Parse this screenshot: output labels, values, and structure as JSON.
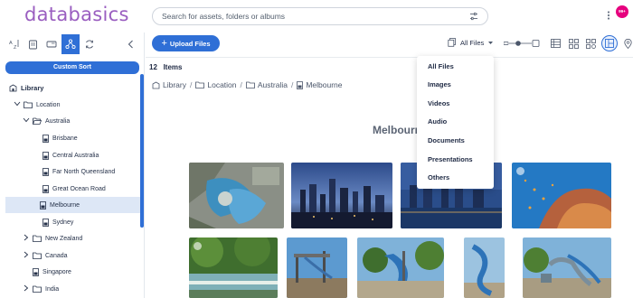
{
  "header": {
    "logo": "databasics",
    "search_placeholder": "Search for assets, folders or albums",
    "notification_badge": "99+"
  },
  "sidebar": {
    "tools": [
      "sort-az-icon",
      "document-icon",
      "card-icon",
      "hierarchy-icon",
      "sync-icon",
      "collapse-icon"
    ],
    "custom_sort_label": "Custom Sort",
    "tree": [
      {
        "label": "Library",
        "level": 0,
        "bold": true,
        "icon": "library-icon"
      },
      {
        "label": "Location",
        "level": 1,
        "expanded": true,
        "icon": "folder-icon"
      },
      {
        "label": "Australia",
        "level": 2,
        "expanded": true,
        "icon": "folder-open-icon"
      },
      {
        "label": "Brisbane",
        "level": 3,
        "icon": "file-icon"
      },
      {
        "label": "Central Australia",
        "level": 3,
        "icon": "file-icon"
      },
      {
        "label": "Far North Queensland",
        "level": 3,
        "icon": "file-icon"
      },
      {
        "label": "Great Ocean Road",
        "level": 3,
        "icon": "file-icon"
      },
      {
        "label": "Melbourne",
        "level": 3,
        "icon": "file-icon",
        "selected": true
      },
      {
        "label": "Sydney",
        "level": 3,
        "icon": "file-icon"
      },
      {
        "label": "New Zealand",
        "level": 2,
        "collapsed": true,
        "icon": "folder-icon"
      },
      {
        "label": "Canada",
        "level": 2,
        "collapsed": true,
        "icon": "folder-icon"
      },
      {
        "label": "Singapore",
        "level": 2,
        "icon": "file-icon"
      },
      {
        "label": "India",
        "level": 2,
        "collapsed": true,
        "icon": "folder-icon"
      }
    ]
  },
  "toolbar": {
    "upload_label": "Upload Files",
    "filter_label": "All Files"
  },
  "main": {
    "items_count": "12",
    "items_label": "Items",
    "breadcrumb": [
      "Library",
      "Location",
      "Australia",
      "Melbourne"
    ],
    "folder_title": "Melbourne"
  },
  "dropdown": {
    "items": [
      "All Files",
      "Images",
      "Videos",
      "Audio",
      "Documents",
      "Presentations",
      "Others"
    ]
  },
  "colors": {
    "accent": "#2f6fd6",
    "logo": "#9a5ec0",
    "badge": "#e6007e"
  }
}
